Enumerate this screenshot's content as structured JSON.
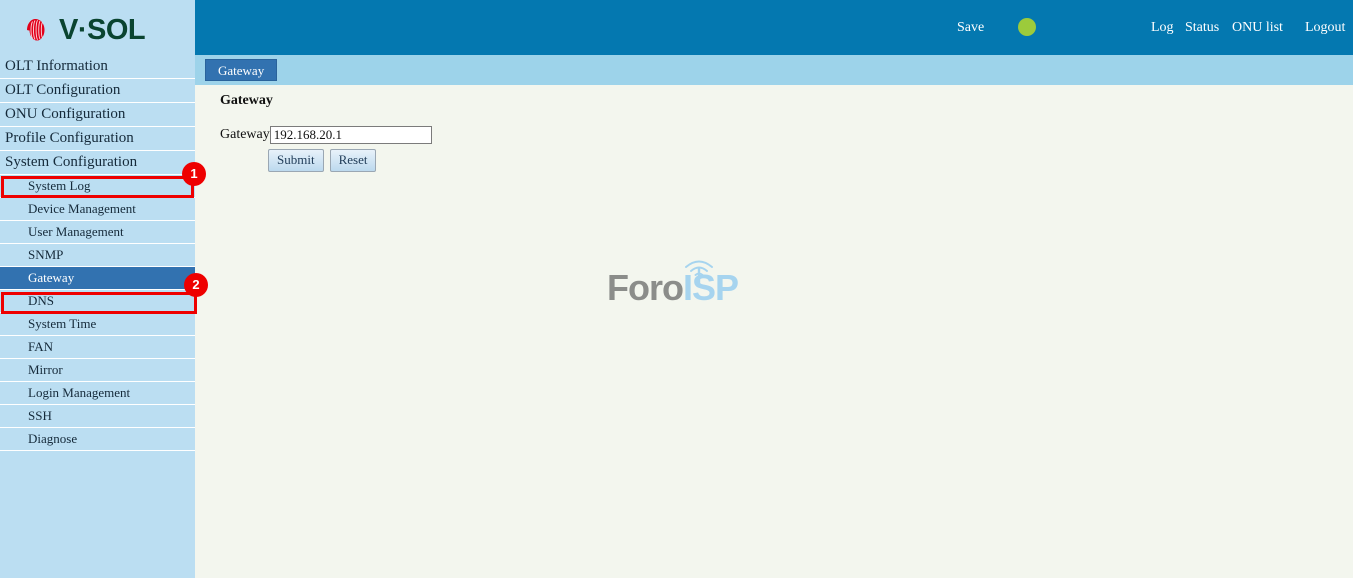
{
  "brand": {
    "logo_text": "V·SOL",
    "logo_mark_icon": "vsol-swirl-icon",
    "logo_mark_color": "#e2001a",
    "logo_text_color": "#0a4430"
  },
  "header": {
    "background_color": "#0478b0",
    "save_label": "Save",
    "status_indicator_icon": "status-circle-icon",
    "status_indicator_color": "#9ccb3b",
    "log_label": "Log",
    "status_label": "Status",
    "onu_list_label": "ONU list",
    "logout_label": "Logout"
  },
  "tabs": {
    "background_color": "#9dd3ea",
    "active_tab_color": "#3272b0",
    "items": [
      {
        "label": "Gateway",
        "active": true
      }
    ]
  },
  "sidebar": {
    "background_color": "#bbdef2",
    "selected_color": "#3272b0",
    "top_items": [
      {
        "label": "OLT Information",
        "selected": false
      },
      {
        "label": "OLT Configuration",
        "selected": false
      },
      {
        "label": "ONU Configuration",
        "selected": false
      },
      {
        "label": "Profile Configuration",
        "selected": false
      },
      {
        "label": "System Configuration",
        "selected": false,
        "expanded": true,
        "annotated": 1
      }
    ],
    "sub_items": [
      {
        "label": "System Log",
        "selected": false
      },
      {
        "label": "Device Management",
        "selected": false
      },
      {
        "label": "User Management",
        "selected": false
      },
      {
        "label": "SNMP",
        "selected": false
      },
      {
        "label": "Gateway",
        "selected": true,
        "annotated": 2
      },
      {
        "label": "DNS",
        "selected": false
      },
      {
        "label": "System Time",
        "selected": false
      },
      {
        "label": "FAN",
        "selected": false
      },
      {
        "label": "Mirror",
        "selected": false
      },
      {
        "label": "Login Management",
        "selected": false
      },
      {
        "label": "SSH",
        "selected": false
      },
      {
        "label": "Diagnose",
        "selected": false
      }
    ]
  },
  "main": {
    "background_color": "#f3f6ee",
    "page_title": "Gateway",
    "form": {
      "gateway_label": "Gateway",
      "gateway_value": "192.168.20.1",
      "gateway_placeholder": "",
      "submit_label": "Submit",
      "reset_label": "Reset"
    }
  },
  "watermark": {
    "text_primary": "Foro",
    "text_secondary": "ISP",
    "primary_color": "#8b8d8a",
    "secondary_color": "#a6d4ef",
    "tower_icon": "antenna-signal-icon"
  },
  "annotations": {
    "color": "#ee0000",
    "steps": [
      {
        "number": "1",
        "target": "System Configuration"
      },
      {
        "number": "2",
        "target": "Gateway"
      }
    ]
  }
}
